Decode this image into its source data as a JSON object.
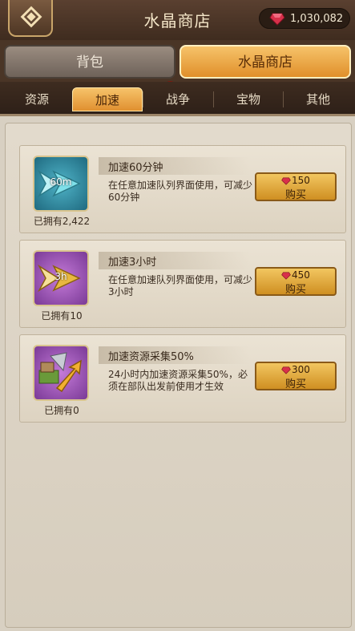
{
  "header": {
    "title": "水晶商店",
    "currency_amount": "1,030,082",
    "back_icon": "diamond-back-icon",
    "gem_icon": "ruby-gem-icon"
  },
  "main_tabs": [
    {
      "label": "背包",
      "active": false,
      "badge": true
    },
    {
      "label": "水晶商店",
      "active": true,
      "badge": false
    }
  ],
  "sub_tabs": [
    {
      "label": "资源",
      "active": false
    },
    {
      "label": "加速",
      "active": true
    },
    {
      "label": "战争",
      "active": false
    },
    {
      "label": "宝物",
      "active": false
    },
    {
      "label": "其他",
      "active": false
    }
  ],
  "items": [
    {
      "icon": "teal-arrow-speedup-icon",
      "icon_text": "60m",
      "owned": "已拥有2,422",
      "name": "加速60分钟",
      "desc": "在任意加速队列界面使用，可减少60分钟",
      "price": "150",
      "buy_label": "购买"
    },
    {
      "icon": "gold-arrow-speedup-icon",
      "icon_text": "3h",
      "owned": "已拥有10",
      "name": "加速3小时",
      "desc": "在任意加速队列界面使用，可减少3小时",
      "price": "450",
      "buy_label": "购买"
    },
    {
      "icon": "resource-gather-speedup-icon",
      "icon_text": "",
      "owned": "已拥有0",
      "name": "加速资源采集50%",
      "desc": "24小时内加速资源采集50%，必须在部队出发前使用才生效",
      "price": "300",
      "buy_label": "购买"
    }
  ],
  "colors": {
    "accent": "#e8a23a",
    "gem": "#d8304a"
  }
}
